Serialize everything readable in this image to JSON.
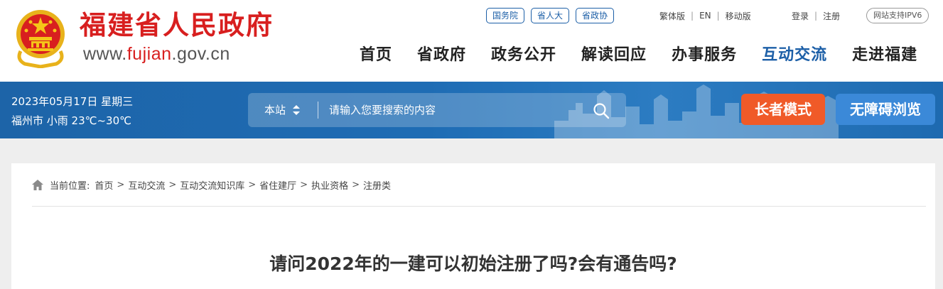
{
  "header": {
    "site_name": "福建省人民政府",
    "url_prefix": "www.",
    "url_highlight": "fujian",
    "url_suffix": ".gov.cn",
    "pills": [
      "国务院",
      "省人大",
      "省政协"
    ],
    "util_links": [
      "繁体版",
      "EN",
      "移动版"
    ],
    "account_links": [
      "登录",
      "注册"
    ],
    "ipv6": "网站支持IPV6",
    "nav": [
      "首页",
      "省政府",
      "政务公开",
      "解读回应",
      "办事服务",
      "互动交流",
      "走进福建"
    ],
    "active_nav": "互动交流"
  },
  "banner": {
    "date": "2023年05月17日 星期三",
    "weather": "福州市 小雨 23℃~30℃",
    "search_scope": "本站",
    "search_placeholder": "请输入您要搜索的内容",
    "elder_mode": "长者模式",
    "accessible": "无障碍浏览"
  },
  "breadcrumb": {
    "label": "当前位置:",
    "items": [
      "首页",
      "互动交流",
      "互动交流知识库",
      "省住建厅",
      "执业资格",
      "注册类"
    ]
  },
  "article": {
    "title": "请问2022年的一建可以初始注册了吗?会有通告吗?"
  },
  "colors": {
    "brand_red": "#d81f1f",
    "brand_blue": "#1c5fa7",
    "elder_orange": "#f05a28",
    "access_blue": "#3b89d8"
  }
}
